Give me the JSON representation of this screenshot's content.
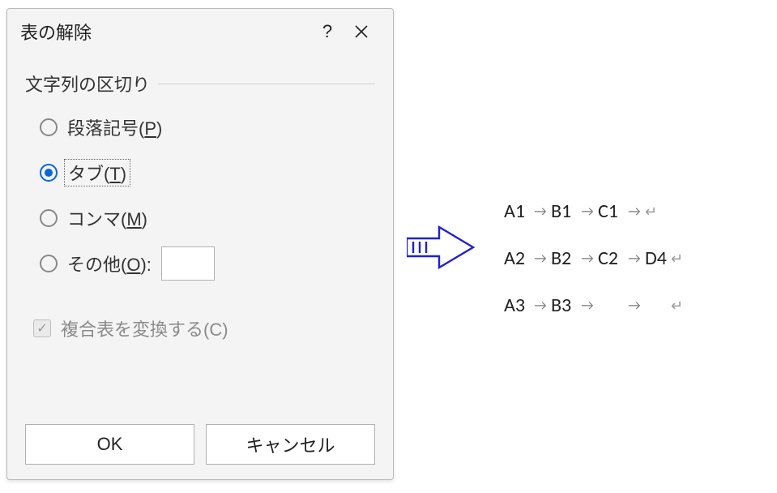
{
  "dialog": {
    "title": "表の解除",
    "help": "?",
    "groupLabel": "文字列の区切り",
    "radios": {
      "paragraph": {
        "label": "段落記号",
        "mnemonic": "P"
      },
      "tab": {
        "label": "タブ",
        "mnemonic": "T"
      },
      "comma": {
        "label": "コンマ",
        "mnemonic": "M"
      },
      "other": {
        "label": "その他",
        "mnemonic": "O",
        "suffix": ":"
      }
    },
    "otherValue": "",
    "checkbox": {
      "label": "複合表を変換する(C)",
      "checked": true
    },
    "buttons": {
      "ok": "OK",
      "cancel": "キャンセル"
    }
  },
  "result": {
    "rows": [
      [
        "A1",
        "B1",
        "C1",
        ""
      ],
      [
        "A2",
        "B2",
        "C2",
        "D4"
      ],
      [
        "A3",
        "B3",
        "",
        ""
      ]
    ]
  }
}
